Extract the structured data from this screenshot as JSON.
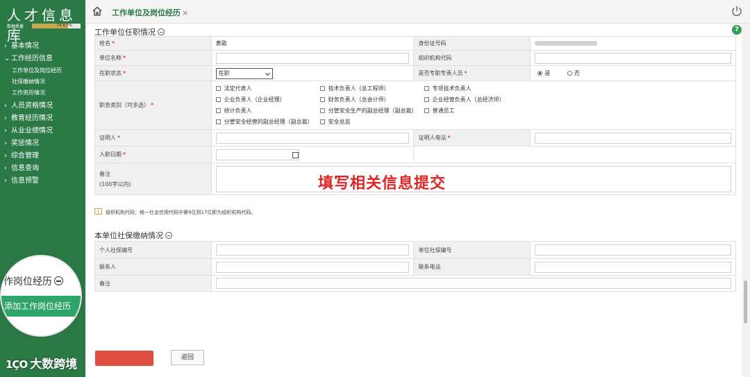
{
  "app": {
    "title": "人才信息库",
    "progress_label": "数据质量",
    "progress_percent": 74.67,
    "progress_text": "74.67%"
  },
  "sidebar": {
    "items": [
      {
        "arrow": "›",
        "label": "基本情况"
      },
      {
        "arrow": "⌄",
        "label": "工作经历信息"
      },
      {
        "arrow": "›",
        "label": "人员资格情况"
      },
      {
        "arrow": "›",
        "label": "教育经历情况"
      },
      {
        "arrow": "›",
        "label": "从业业绩情况"
      },
      {
        "arrow": "›",
        "label": "奖惩情况"
      },
      {
        "arrow": "›",
        "label": "综合管理"
      },
      {
        "arrow": "›",
        "label": "信息查询"
      },
      {
        "arrow": "›",
        "label": "信息预警"
      }
    ],
    "sub_items": [
      "工作单位及岗位经历",
      "社保缴纳情况",
      "工作资历情况"
    ]
  },
  "topbar": {
    "tab_label": "工作单位及岗位经历",
    "tab_close": "×"
  },
  "help_glyph": "?",
  "section1": {
    "title": "工作单位任职情况",
    "name_label": "姓名",
    "name_value": "黄歌",
    "id_label": "身份证号码",
    "unit_label": "单位名称",
    "org_code_label": "组织机构代码",
    "status_label": "在职状态",
    "status_value": "在职",
    "fulltime_label": "是否专职专责人员",
    "radio_yes": "是",
    "radio_no": "否",
    "position_label": "职务类别（可多选）",
    "positions": [
      "法定代表人",
      "技术负责人（总工程师）",
      "专项技术负责人",
      "企业负责人（企业经理）",
      "财务负责人（总会计师）",
      "企业经营负责人（总经济师）",
      "统计负责人",
      "分管安全生产的副总经理（副总裁）",
      "普通员工",
      "分管安全经营的副总经理（副总裁）",
      "安全总监"
    ],
    "witness_label": "证明人",
    "witness_phone_label": "证明人电话",
    "entry_date_label": "入职日期",
    "remark_label": "备注",
    "remark_hint": "(100字以内)",
    "req_mark": "*"
  },
  "note_text": "组织机构代码：统一社会信用代码中第9位到17位即为组织机构代码。",
  "overlay_text": "填写相关信息提交",
  "section2": {
    "title": "本单位社保缴纳情况",
    "personal_no_label": "个人社保编号",
    "unit_no_label": "单位社保编号",
    "contact_label": "联系人",
    "phone_label": "联系电话",
    "remark_label": "备注"
  },
  "magnifier": {
    "title": "作岗位经历",
    "button_label": "添加工作岗位经历"
  },
  "back_button": "返回",
  "watermark": {
    "logo": "1ÇO",
    "text": "大数跨境"
  },
  "colors": {
    "sidebar": "#2b7a46",
    "accent_red": "#e02424",
    "add_button": "#2ea46a"
  }
}
